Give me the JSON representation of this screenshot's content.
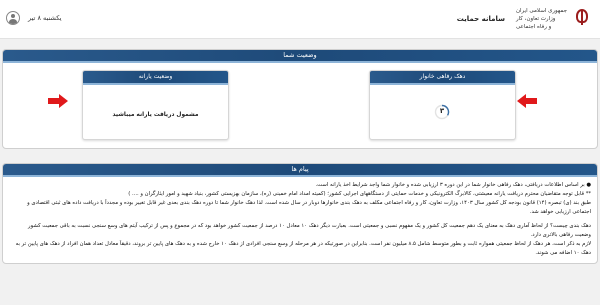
{
  "header": {
    "brand_line_1": "جمهوری اسلامی ایران",
    "brand_line_2": "وزارت تعاون، کار",
    "brand_line_3": "و رفاه اجتماعی",
    "system_name": "سامانه حمایت",
    "date": "یکشنبه ۸ تیر"
  },
  "status_section": {
    "title": "وضعیت شما",
    "subsidy_card": {
      "title": "وضعیت یارانه",
      "status": "مشمول دریافت یارانه میباشید"
    },
    "decile_card": {
      "title": "دهک رفاهی خانوار",
      "decile": "۳"
    }
  },
  "messages_section": {
    "title": "پیام ها",
    "lines": [
      "● بر اساس اطلاعات دریافتی، دهک رفاهی خانوار شما در این دوره ۳ ارزیابی شده و خانوار شما واجد شرایط اخذ یارانه است.",
      "** قابل توجه متقاضیان محترم دریافت یارانه معیشتی، کالابرگ الکترونیکی و خدمات حمایتی از دستگاههای اجرایی کشور؛ (کمیته امداد امام خمینی (ره)، سازمان بهزیستی کشور، بنیاد شهید و امور ایثارگران و .... )",
      "طبق بند (ی) تبصره (۱۴) قانون بودجه کل کشور سال ۱۴۰۳، وزارت تعاون، کار و رفاه اجتماعی مکلف به دهک بندی خانوارها دوبار در سال شده است. لذا دهک خانوار شما تا دوره دهک بندی بعدی غیر قابل تغییر بوده و مجدداً با دریافت داده های ثبتی اقتصادی و",
      "اجتماعی ارزیابی خواهد شد.",
      "دهک بندی چیست؟ از لحاظ آماری دهک به معنای یک دهم جمعیت کل کشور و یک مفهوم نسبی و جمعیتی است. بعبارت دیگر دهک ۱۰ معادل ۱۰ درصد از جمعیت کشور خواهد بود که در مجموع و پس از ترکیب آیتم های وسع سنجی نسبت به باقی جمعیت کشور",
      "وضعیت رفاهی بالاتری دارد.",
      "لازم به ذکر است، هر دهک از لحاظ جمعیتی همواره ثابت و بطور متوسط شامل ۸.۵ میلیون نفر است. بنابراین در صورتیکه در هر مرحله از وسع سنجی افرادی از دهک ۱۰ خارج شده و به دهک های پایین تر بروند، دقیقاً معادل تعداد همان افراد از دهک های پایین تر به",
      "دهک ۱۰ اضافه می شوند."
    ]
  },
  "colors": {
    "header_blue": "#23568a",
    "arrow_red": "#e0191b"
  }
}
